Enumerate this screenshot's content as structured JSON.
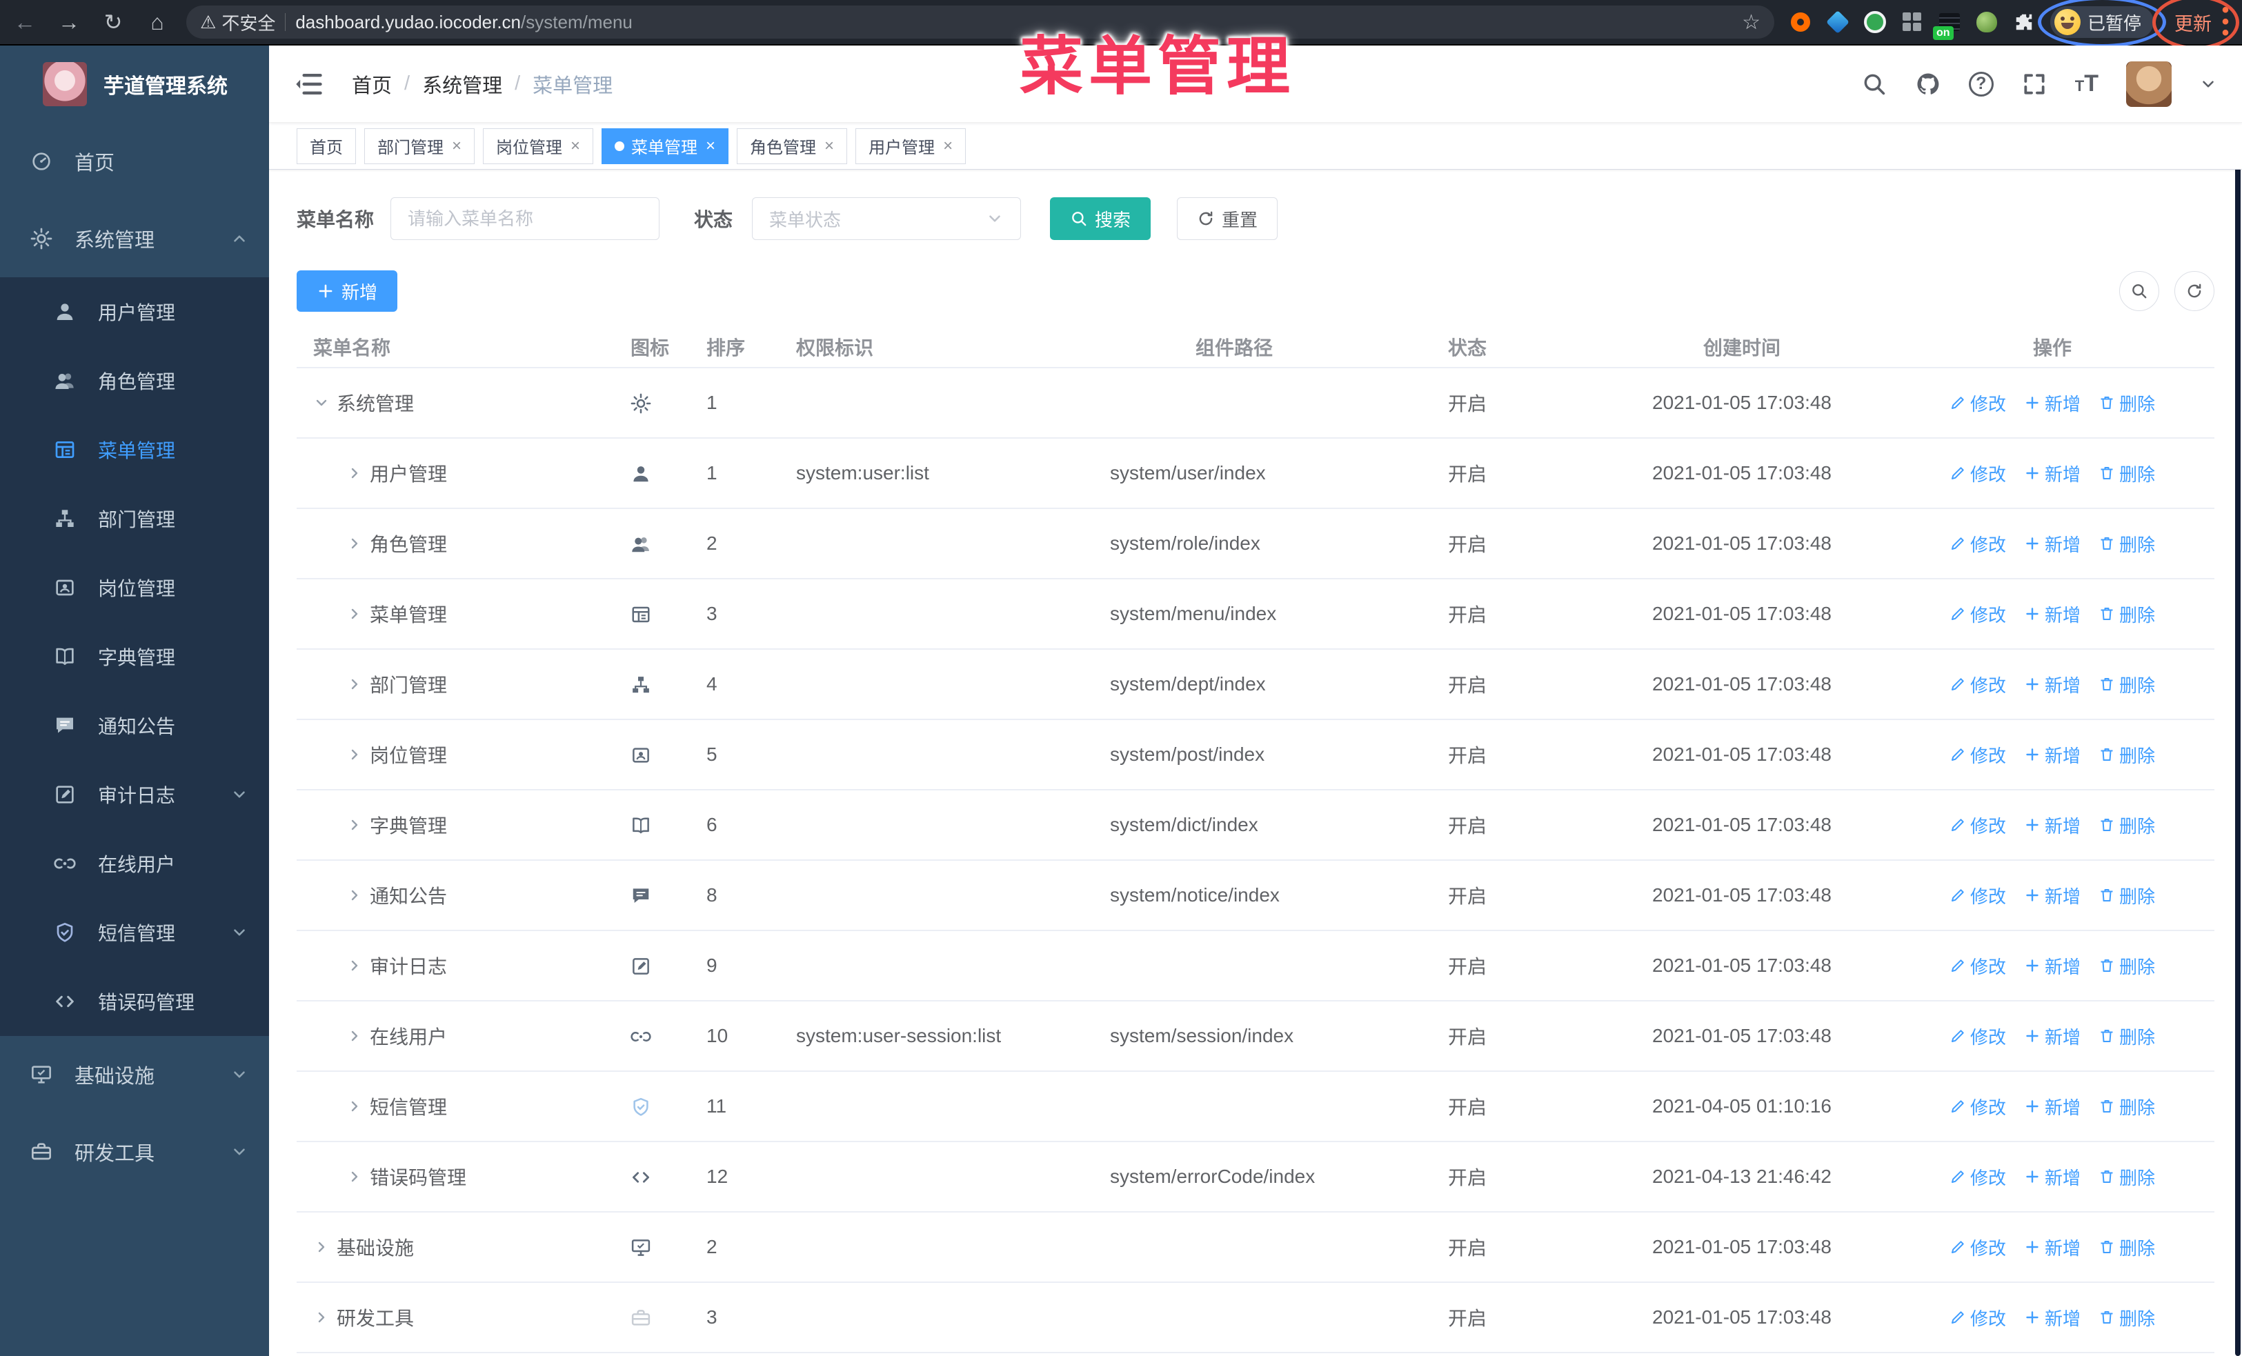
{
  "colors": {
    "accent": "#409eff",
    "teal": "#24b6a6",
    "overlay_red": "#f43a5e",
    "sidebar_bg": "#2e4a63",
    "sidebar_sub_bg": "#213349",
    "active_tab_bg": "#409eff"
  },
  "browser": {
    "security_label": "不安全",
    "url_host": "dashboard.yudao.iocoder.cn",
    "url_path": "/system/menu",
    "server_badge": "on",
    "paused_badge": "已暂停",
    "update_button": "更新",
    "kebab": "⋮"
  },
  "overlay_title": "菜单管理",
  "sidebar": {
    "app_title": "芋道管理系统",
    "items": [
      {
        "label": "首页",
        "icon": "dashboard-icon",
        "type": "top"
      },
      {
        "label": "系统管理",
        "icon": "gear-icon",
        "type": "top",
        "caret": "up"
      },
      {
        "label": "用户管理",
        "icon": "user-icon",
        "type": "sub"
      },
      {
        "label": "角色管理",
        "icon": "users-icon",
        "type": "sub"
      },
      {
        "label": "菜单管理",
        "icon": "list-icon",
        "type": "sub",
        "active": true
      },
      {
        "label": "部门管理",
        "icon": "tree-icon",
        "type": "sub"
      },
      {
        "label": "岗位管理",
        "icon": "badge-icon",
        "type": "sub"
      },
      {
        "label": "字典管理",
        "icon": "book-icon",
        "type": "sub"
      },
      {
        "label": "通知公告",
        "icon": "message-icon",
        "type": "sub"
      },
      {
        "label": "审计日志",
        "icon": "edit-icon",
        "type": "sub",
        "caret": "down"
      },
      {
        "label": "在线用户",
        "icon": "link-icon",
        "type": "sub"
      },
      {
        "label": "短信管理",
        "icon": "shield-icon",
        "type": "sub",
        "caret": "down",
        "tone": "dim"
      },
      {
        "label": "错误码管理",
        "icon": "code-icon",
        "type": "sub"
      },
      {
        "label": "基础设施",
        "icon": "monitor-icon",
        "type": "top",
        "caret": "down"
      },
      {
        "label": "研发工具",
        "icon": "toolbox-icon",
        "type": "top",
        "caret": "down",
        "tone": "faint"
      }
    ]
  },
  "header": {
    "breadcrumb": [
      "首页",
      "系统管理",
      "菜单管理"
    ],
    "font_icon_text": "tT"
  },
  "tags": [
    {
      "label": "首页",
      "closable": false,
      "active": false
    },
    {
      "label": "部门管理",
      "closable": true,
      "active": false
    },
    {
      "label": "岗位管理",
      "closable": true,
      "active": false
    },
    {
      "label": "菜单管理",
      "closable": true,
      "active": true
    },
    {
      "label": "角色管理",
      "closable": true,
      "active": false
    },
    {
      "label": "用户管理",
      "closable": true,
      "active": false
    }
  ],
  "filters": {
    "name_label": "菜单名称",
    "name_placeholder": "请输入菜单名称",
    "name_value": "",
    "status_label": "状态",
    "status_placeholder": "菜单状态",
    "search_label": "搜索",
    "reset_label": "重置"
  },
  "toolbar": {
    "add_label": "新增"
  },
  "actions": {
    "edit": "修改",
    "add": "新增",
    "delete": "删除"
  },
  "table": {
    "columns": [
      "菜单名称",
      "图标",
      "排序",
      "权限标识",
      "组件路径",
      "状态",
      "创建时间",
      "操作"
    ],
    "rows": [
      {
        "level": 0,
        "expanded": true,
        "name": "系统管理",
        "icon": "gear-icon",
        "sort": "1",
        "perm": "",
        "path": "",
        "status": "开启",
        "time": "2021-01-05 17:03:48"
      },
      {
        "level": 1,
        "expanded": false,
        "name": "用户管理",
        "icon": "user-icon",
        "sort": "1",
        "perm": "system:user:list",
        "path": "system/user/index",
        "status": "开启",
        "time": "2021-01-05 17:03:48"
      },
      {
        "level": 1,
        "expanded": false,
        "name": "角色管理",
        "icon": "users-icon",
        "sort": "2",
        "perm": "",
        "path": "system/role/index",
        "status": "开启",
        "time": "2021-01-05 17:03:48"
      },
      {
        "level": 1,
        "expanded": false,
        "name": "菜单管理",
        "icon": "list-icon",
        "sort": "3",
        "perm": "",
        "path": "system/menu/index",
        "status": "开启",
        "time": "2021-01-05 17:03:48"
      },
      {
        "level": 1,
        "expanded": false,
        "name": "部门管理",
        "icon": "tree-icon",
        "sort": "4",
        "perm": "",
        "path": "system/dept/index",
        "status": "开启",
        "time": "2021-01-05 17:03:48"
      },
      {
        "level": 1,
        "expanded": false,
        "name": "岗位管理",
        "icon": "badge-icon",
        "sort": "5",
        "perm": "",
        "path": "system/post/index",
        "status": "开启",
        "time": "2021-01-05 17:03:48"
      },
      {
        "level": 1,
        "expanded": false,
        "name": "字典管理",
        "icon": "book-icon",
        "sort": "6",
        "perm": "",
        "path": "system/dict/index",
        "status": "开启",
        "time": "2021-01-05 17:03:48"
      },
      {
        "level": 1,
        "expanded": false,
        "name": "通知公告",
        "icon": "message-icon",
        "sort": "8",
        "perm": "",
        "path": "system/notice/index",
        "status": "开启",
        "time": "2021-01-05 17:03:48"
      },
      {
        "level": 1,
        "expanded": false,
        "name": "审计日志",
        "icon": "edit-icon",
        "sort": "9",
        "perm": "",
        "path": "",
        "status": "开启",
        "time": "2021-01-05 17:03:48"
      },
      {
        "level": 1,
        "expanded": false,
        "name": "在线用户",
        "icon": "link-icon",
        "sort": "10",
        "perm": "system:user-session:list",
        "path": "system/session/index",
        "status": "开启",
        "time": "2021-01-05 17:03:48"
      },
      {
        "level": 1,
        "expanded": false,
        "name": "短信管理",
        "icon": "shield-icon",
        "sort": "11",
        "perm": "",
        "path": "",
        "status": "开启",
        "time": "2021-04-05 01:10:16",
        "tone": "dim"
      },
      {
        "level": 1,
        "expanded": false,
        "name": "错误码管理",
        "icon": "code-icon",
        "sort": "12",
        "perm": "",
        "path": "system/errorCode/index",
        "status": "开启",
        "time": "2021-04-13 21:46:42"
      },
      {
        "level": 0,
        "expanded": false,
        "name": "基础设施",
        "icon": "monitor-icon",
        "sort": "2",
        "perm": "",
        "path": "",
        "status": "开启",
        "time": "2021-01-05 17:03:48"
      },
      {
        "level": 0,
        "expanded": false,
        "name": "研发工具",
        "icon": "toolbox-icon",
        "sort": "3",
        "perm": "",
        "path": "",
        "status": "开启",
        "time": "2021-01-05 17:03:48",
        "tone": "faint"
      }
    ]
  }
}
